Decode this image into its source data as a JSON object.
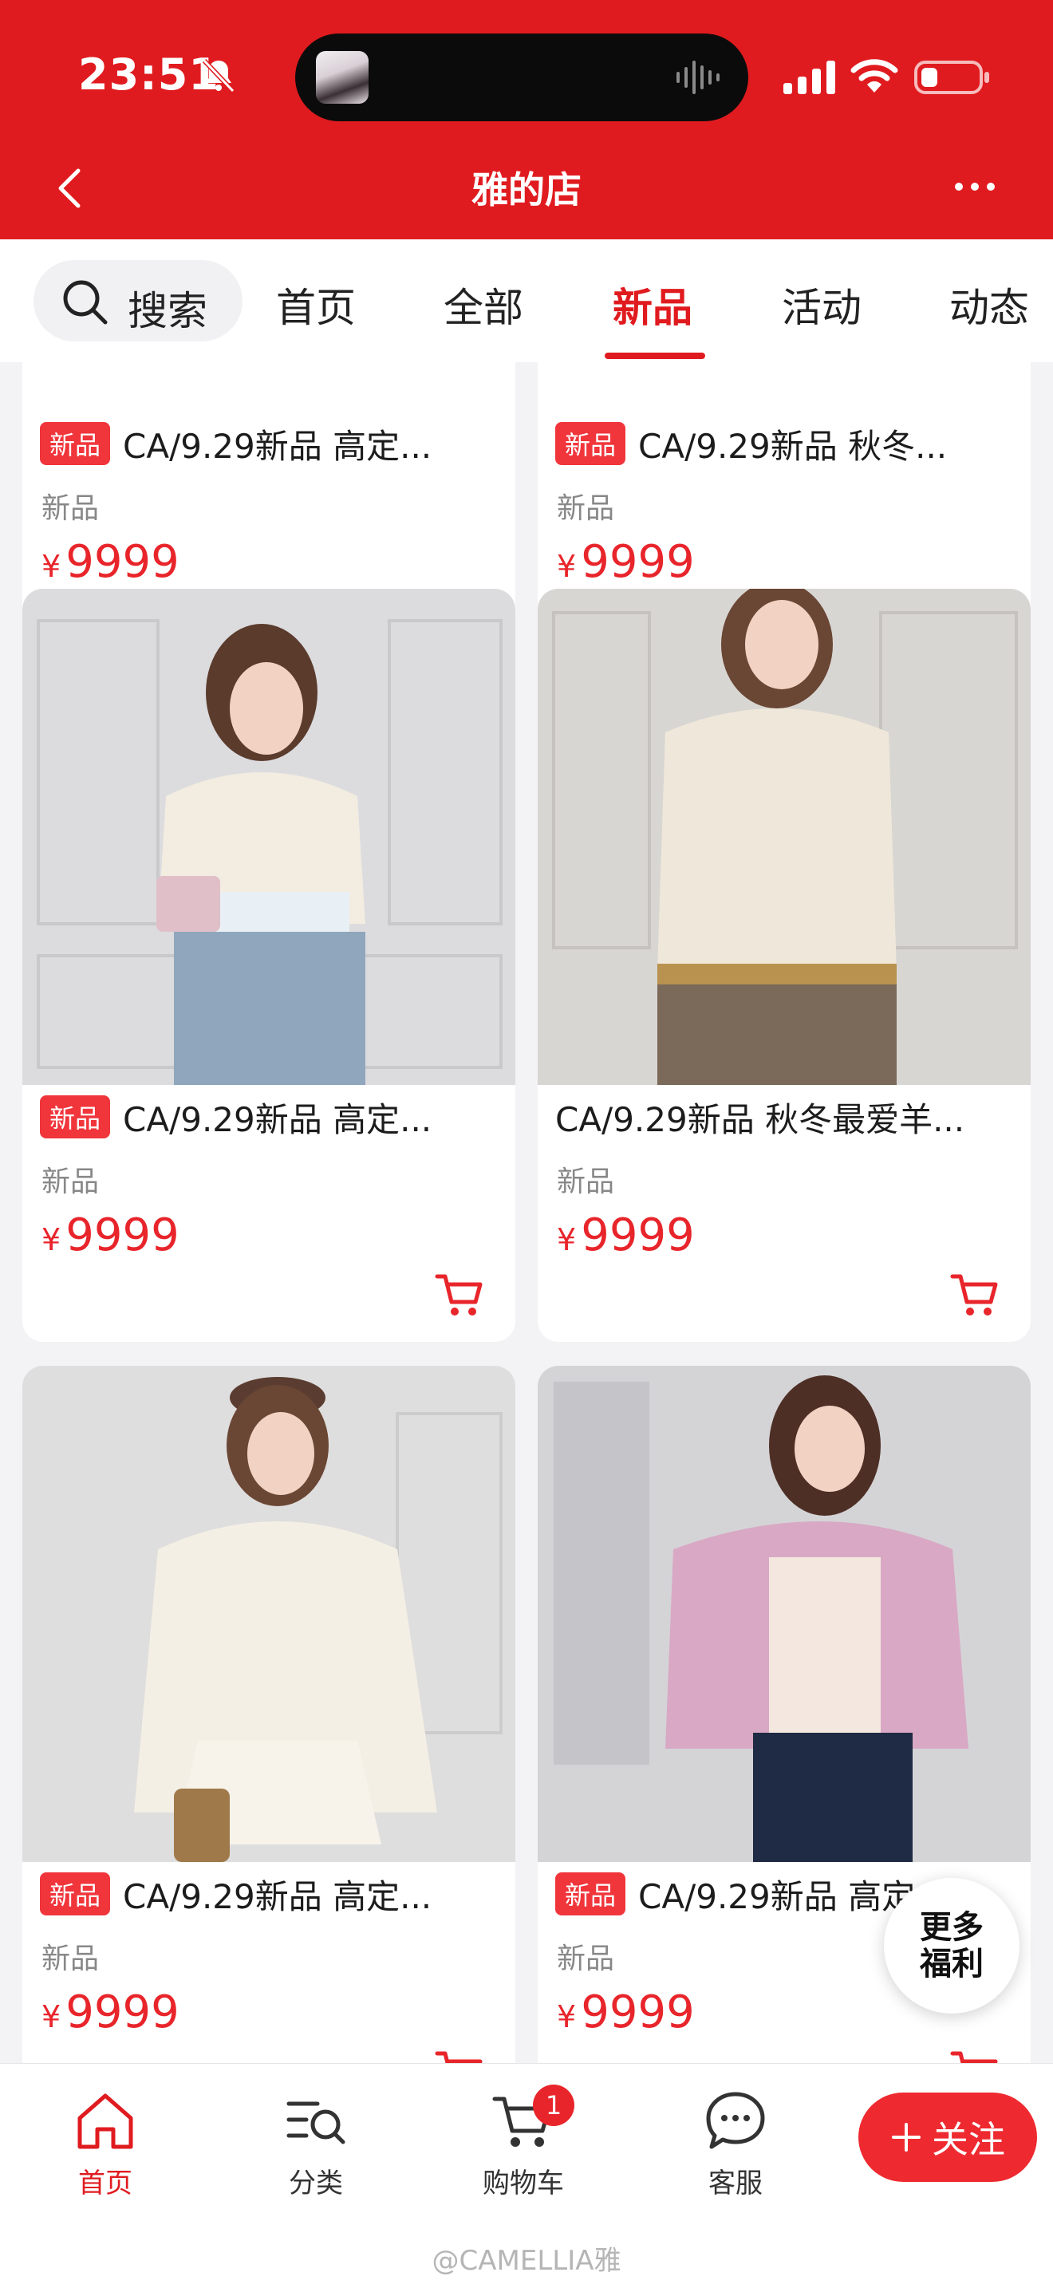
{
  "status_bar": {
    "time": "23:51"
  },
  "header": {
    "title": "雅的店"
  },
  "tabs": {
    "search_label": "搜索",
    "items": [
      "首页",
      "全部",
      "新品",
      "活动",
      "动态"
    ],
    "active": "新品"
  },
  "products": [
    {
      "title": "CA/9.29新品 高定...",
      "badge": "新品",
      "tag": "新品",
      "currency": "¥",
      "price": "9999"
    },
    {
      "title": "CA/9.29新品 秋冬...",
      "badge": "新品",
      "tag": "新品",
      "currency": "¥",
      "price": "9999"
    },
    {
      "title": "CA/9.29新品 高定...",
      "badge": "新品",
      "tag": "新品",
      "currency": "¥",
      "price": "9999"
    },
    {
      "title": "CA/9.29新品 秋冬最爱羊...",
      "badge": "",
      "tag": "新品",
      "currency": "¥",
      "price": "9999"
    },
    {
      "title": "CA/9.29新品 高定...",
      "badge": "新品",
      "tag": "新品",
      "currency": "¥",
      "price": "9999"
    },
    {
      "title": "CA/9.29新品 高定...",
      "badge": "新品",
      "tag": "新品",
      "currency": "¥",
      "price": "9999"
    }
  ],
  "floating": {
    "more_benefits": "更多福利"
  },
  "bottom_nav": {
    "home": "首页",
    "category": "分类",
    "cart": "购物车",
    "cart_count": "1",
    "service": "客服",
    "follow": "关注"
  },
  "watermark": "@CAMELLIA雅",
  "colors": {
    "brand_red": "#e01b1f",
    "price_red": "#e8252b"
  }
}
